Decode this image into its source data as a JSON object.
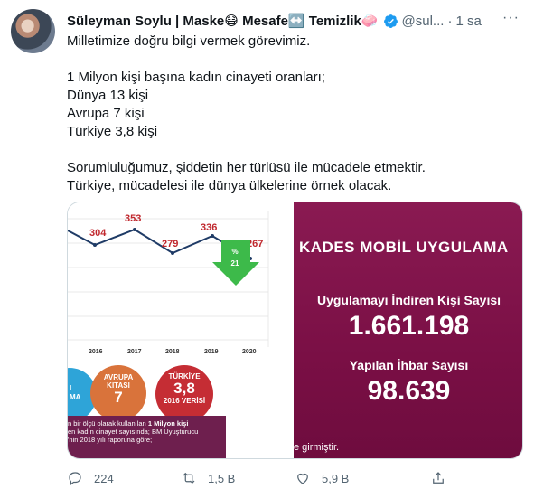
{
  "tweet": {
    "author_name": "Süleyman Soylu | Maske😷 Mesafe↔️ Temizlik🧼",
    "handle": "@sul...",
    "dot": "·",
    "time": "1 sa",
    "text": "Milletimize doğru bilgi vermek görevimiz.\n\n1 Milyon kişi başına kadın cinayeti oranları;\nDünya 13 kişi\nAvrupa 7 kişi\nTürkiye 3,8 kişi\n\nSorumluluğumuz, şiddetin her türlüsü ile mücadele etmektir.\nTürkiye, mücadelesi ile dünya ülkelerine örnek olacak."
  },
  "media": {
    "chart_values": [
      "304",
      "353",
      "279",
      "336",
      "267"
    ],
    "chart_years": [
      "2016",
      "2017",
      "2018",
      "2019",
      "2020"
    ],
    "arrow_percent": "%",
    "arrow_value": "21",
    "circle_blue_l1": "L",
    "circle_blue_l2": "MA",
    "circle_orange_l1": "AVRUPA",
    "circle_orange_l2": "KITASI",
    "circle_orange_num": "7",
    "circle_red_l1": "TÜRKİYE",
    "circle_red_num": "3,8",
    "circle_red_l2": "2016 VERİSİ",
    "caption_line1_a": "n bir ölçü olarak kullanılan ",
    "caption_line1_b": "1 Milyon kişi",
    "caption_line2": "en kadın cinayet sayısında; BM Uyuşturucu",
    "caption_line3": "'nin 2018 yılı raporuna göre;",
    "kades_title": "KADES MOBİL UYGULAMA",
    "downloads_label": "Uygulamayı İndiren Kişi Sayısı",
    "downloads_value": "1.661.198",
    "reports_label": "Yapılan İhbar Sayısı",
    "reports_value": "98.639",
    "footer_text": "e girmiştir."
  },
  "actions": {
    "reply_count": "224",
    "retweet_count": "1,5 B",
    "like_count": "5,9 B"
  },
  "colors": {
    "kades_bg": "#7a0f45",
    "chart_red": "#c0272d",
    "arrow_green": "#3dba4a",
    "circle_blue": "#2ea4d8",
    "circle_orange": "#d9733b",
    "circle_red": "#c52d34"
  }
}
